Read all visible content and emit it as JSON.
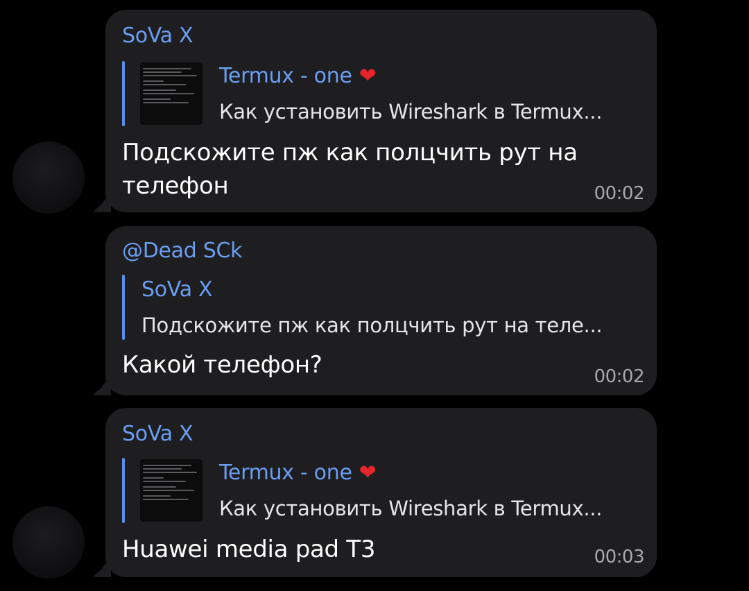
{
  "messages": [
    {
      "sender": "SoVa X",
      "reply": {
        "title": "Termux - one",
        "title_emoji": "❤",
        "text": "Как установить Wireshark в Termux...",
        "has_thumbnail": true
      },
      "text_line1": "Подскожите пж как полцчить рут на",
      "text_line2": "телефон",
      "time": "00:02"
    },
    {
      "sender": "@Dead SCk",
      "reply": {
        "title": "SoVa X",
        "text": "Подскожите пж как полцчить рут на теле...",
        "has_thumbnail": false
      },
      "text_line1": "Какой телефон?",
      "time": "00:02"
    },
    {
      "sender": "SoVa X",
      "reply": {
        "title": "Termux - one",
        "title_emoji": "❤",
        "text": "Как установить Wireshark в Termux...",
        "has_thumbnail": true
      },
      "text_line1": "Huawei media pad T3",
      "time": "00:03"
    }
  ],
  "colors": {
    "background": "#000000",
    "bubble": "#1e1e20",
    "accent_name": "#6a9ef2",
    "reply_bar": "#5b8ee6",
    "time": "#a9a9ad",
    "heart": "#e3262b"
  }
}
